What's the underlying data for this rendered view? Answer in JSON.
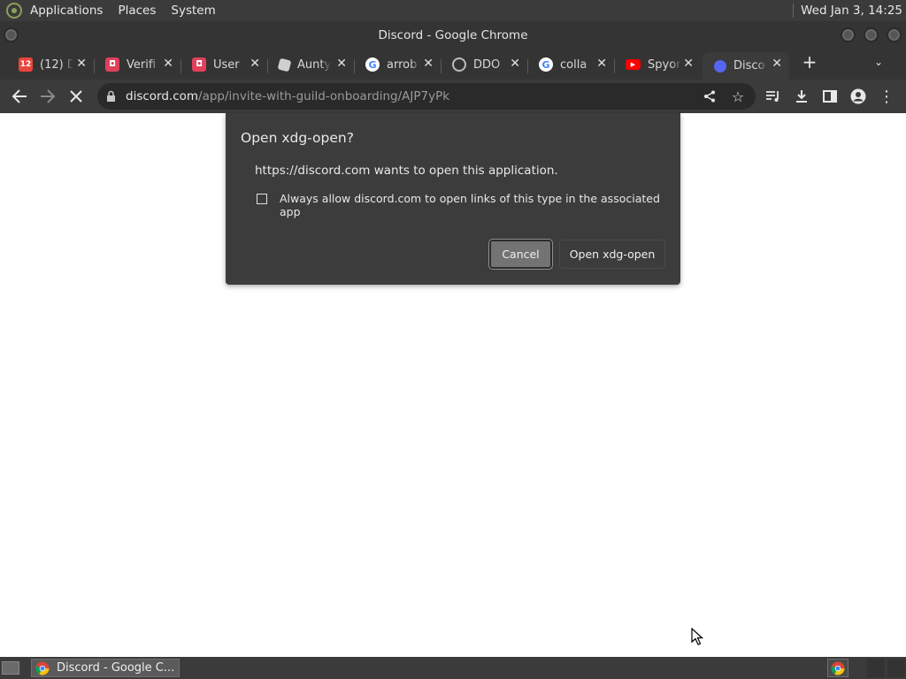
{
  "panel": {
    "menus": [
      "Applications",
      "Places",
      "System"
    ],
    "clock": "Wed Jan  3, 14:25"
  },
  "window": {
    "title": "Discord - Google Chrome"
  },
  "tabs": [
    {
      "label": "(12) D",
      "icon": "google-calendar-icon",
      "active": false
    },
    {
      "label": "Verifi",
      "icon": "bot-app-icon",
      "active": false
    },
    {
      "label": "User",
      "icon": "bot-app-icon",
      "active": false
    },
    {
      "label": "Aunty",
      "icon": "roblox-icon",
      "active": false
    },
    {
      "label": "arrob",
      "icon": "google-icon",
      "active": false
    },
    {
      "label": "DDO",
      "icon": "globe-icon",
      "active": false
    },
    {
      "label": "colla",
      "icon": "google-icon",
      "active": false
    },
    {
      "label": "Spyor",
      "icon": "youtube-icon",
      "active": false
    },
    {
      "label": "Disco",
      "icon": "discord-icon",
      "active": true
    }
  ],
  "toolbar": {
    "url_host": "discord.com",
    "url_path": "/app/invite-with-guild-onboarding/AJP7yPk"
  },
  "dialog": {
    "title": "Open xdg-open?",
    "message": "https://discord.com wants to open this application.",
    "checkbox_label": "Always allow discord.com to open links of this type in the associated app",
    "checkbox_checked": false,
    "cancel_label": "Cancel",
    "open_label": "Open xdg-open"
  },
  "taskbar": {
    "task_label": "Discord - Google C..."
  },
  "colors": {
    "panel_bg": "#3b3b3b",
    "dialog_bg": "#3c3c3c",
    "cancel_bg": "#737373",
    "youtube_red": "#ff0000",
    "discord_blurple": "#5865f2"
  }
}
